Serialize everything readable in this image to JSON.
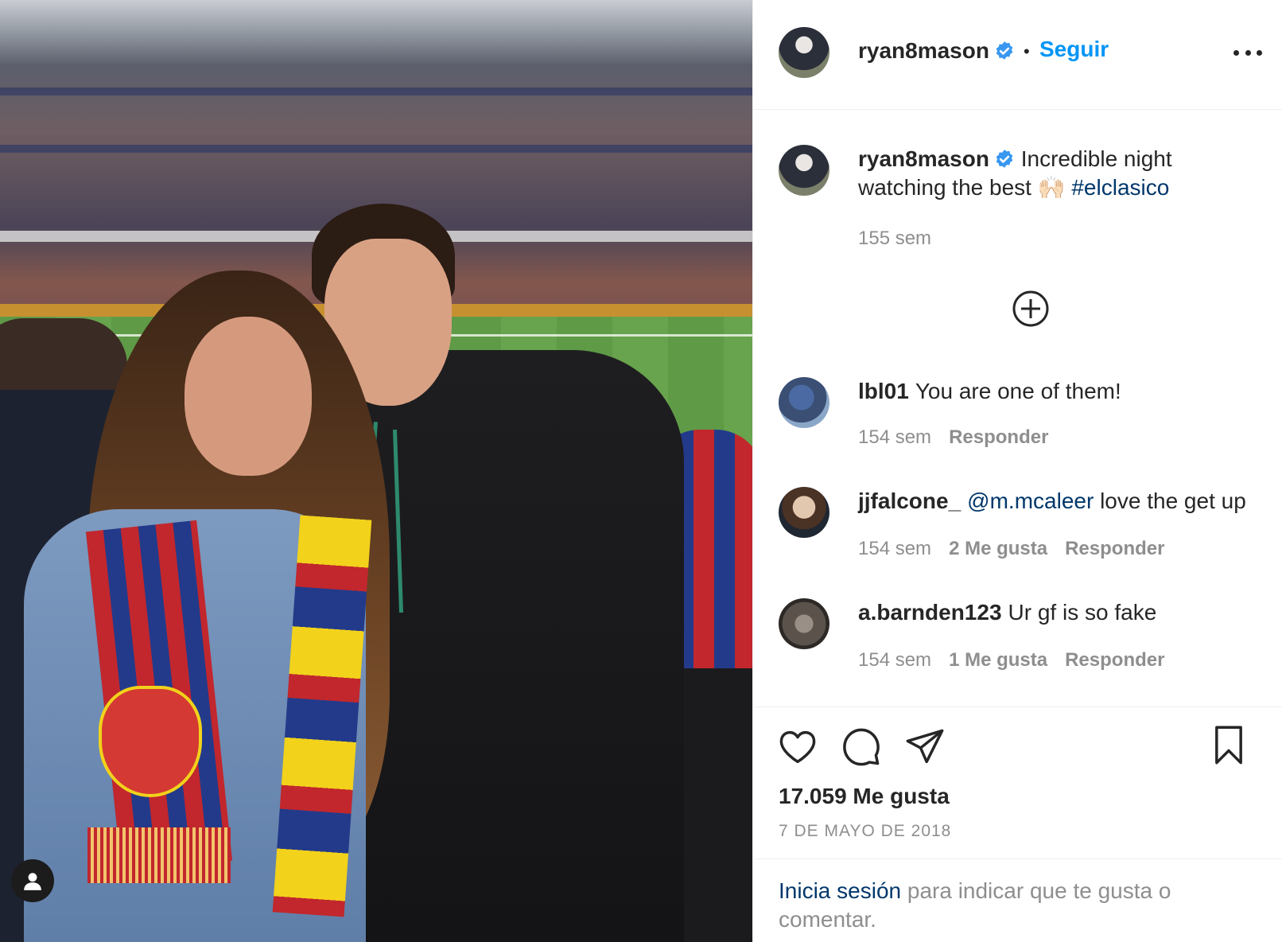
{
  "post": {
    "author": "ryan8mason",
    "verified": true,
    "follow_label": "Seguir",
    "separator": "•",
    "caption_text": "Incredible night watching the best",
    "caption_emoji": "🙌🏻",
    "caption_hashtag": "#elclasico",
    "caption_time": "155 sem"
  },
  "comments": [
    {
      "user": "lbl01",
      "text": "You are one of them!",
      "time": "154 sem",
      "likes": "",
      "reply": "Responder"
    },
    {
      "user": "jjfalcone_",
      "mention": "@m.mcaleer",
      "text": "love the get up",
      "time": "154 sem",
      "likes": "2 Me gusta",
      "reply": "Responder"
    },
    {
      "user": "a.barnden123",
      "text": "Ur gf is so fake",
      "time": "154 sem",
      "likes": "1 Me gusta",
      "reply": "Responder"
    }
  ],
  "stats": {
    "likes": "17.059 Me gusta",
    "date": "7 DE MAYO DE 2018"
  },
  "login": {
    "link": "Inicia sesión",
    "rest": "para indicar que te gusta o comentar."
  },
  "icons": {
    "verified": "verified-badge-icon",
    "more": "more-options-icon",
    "load_more": "plus-circle-icon",
    "like": "heart-icon",
    "comment": "comment-bubble-icon",
    "share": "paper-plane-icon",
    "save": "bookmark-icon",
    "tagged": "user-tag-icon"
  },
  "colors": {
    "link_blue": "#0095f6",
    "hashtag_blue": "#00376b",
    "verified_blue": "#3897f0",
    "muted": "#8e8e8e",
    "text": "#262626"
  }
}
